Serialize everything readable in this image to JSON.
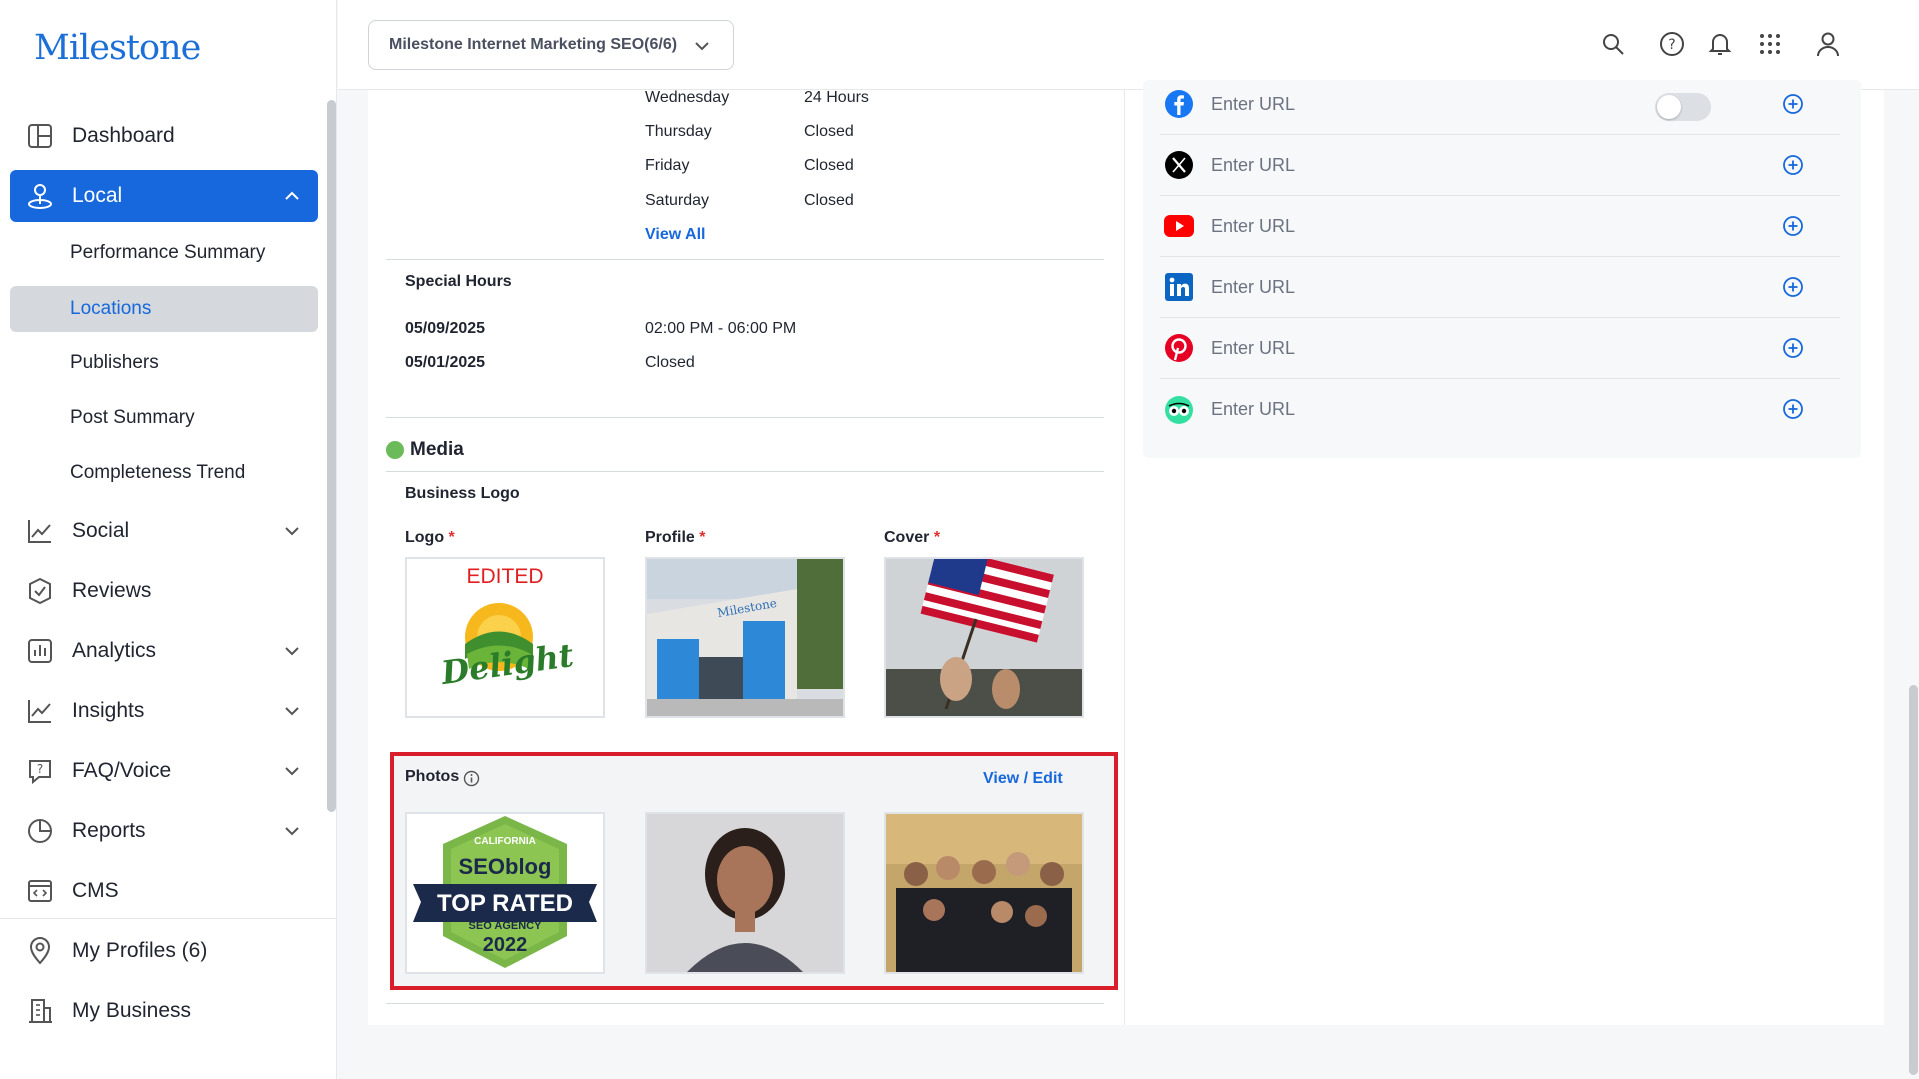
{
  "app": {
    "logo": "Milestone"
  },
  "sidebar": {
    "items": [
      {
        "label": "Dashboard"
      },
      {
        "label": "Local"
      },
      {
        "label": "Social"
      },
      {
        "label": "Reviews"
      },
      {
        "label": "Analytics"
      },
      {
        "label": "Insights"
      },
      {
        "label": "FAQ/Voice"
      },
      {
        "label": "Reports"
      },
      {
        "label": "CMS"
      },
      {
        "label": "My Profiles (6)"
      },
      {
        "label": "My Business"
      }
    ],
    "local_sub": [
      "Performance Summary",
      "Locations",
      "Publishers",
      "Post Summary",
      "Completeness Trend"
    ]
  },
  "topbar": {
    "account_selector": "Milestone Internet Marketing SEO(6/6)"
  },
  "hours": {
    "rows": [
      {
        "day": "Wednesday",
        "value": "24 Hours"
      },
      {
        "day": "Thursday",
        "value": "Closed"
      },
      {
        "day": "Friday",
        "value": "Closed"
      },
      {
        "day": "Saturday",
        "value": "Closed"
      }
    ],
    "view_all": "View All"
  },
  "special_hours": {
    "title": "Special Hours",
    "rows": [
      {
        "date": "05/09/2025",
        "value": "02:00 PM - 06:00 PM"
      },
      {
        "date": "05/01/2025",
        "value": "Closed"
      }
    ]
  },
  "media": {
    "title": "Media",
    "status_color": "#6cbb5a",
    "business_logo": "Business Logo",
    "logo_label": "Logo",
    "profile_label": "Profile",
    "cover_label": "Cover",
    "required_mark": "*",
    "logo_overlay": "EDITED",
    "logo_text": "Delight",
    "profile_sign": "Milestone",
    "photos_label": "Photos",
    "view_edit": "View / Edit",
    "badge": {
      "top": "CALIFORNIA",
      "brand": "SEOblog",
      "main": "TOP RATED",
      "sub": "SEO AGENCY",
      "year": "2022"
    }
  },
  "social": {
    "placeholder": "Enter URL",
    "rows": [
      {
        "icon": "facebook-icon",
        "color": "#1877f2"
      },
      {
        "icon": "x-icon",
        "color": "#000000"
      },
      {
        "icon": "youtube-icon",
        "color": "#ff0000"
      },
      {
        "icon": "linkedin-icon",
        "color": "#0a66c2"
      },
      {
        "icon": "pinterest-icon",
        "color": "#e60023"
      },
      {
        "icon": "tripadvisor-icon",
        "color": "#34e0a1"
      }
    ]
  },
  "colors": {
    "accent": "#1668dc",
    "highlight_border": "#d81e2a"
  }
}
